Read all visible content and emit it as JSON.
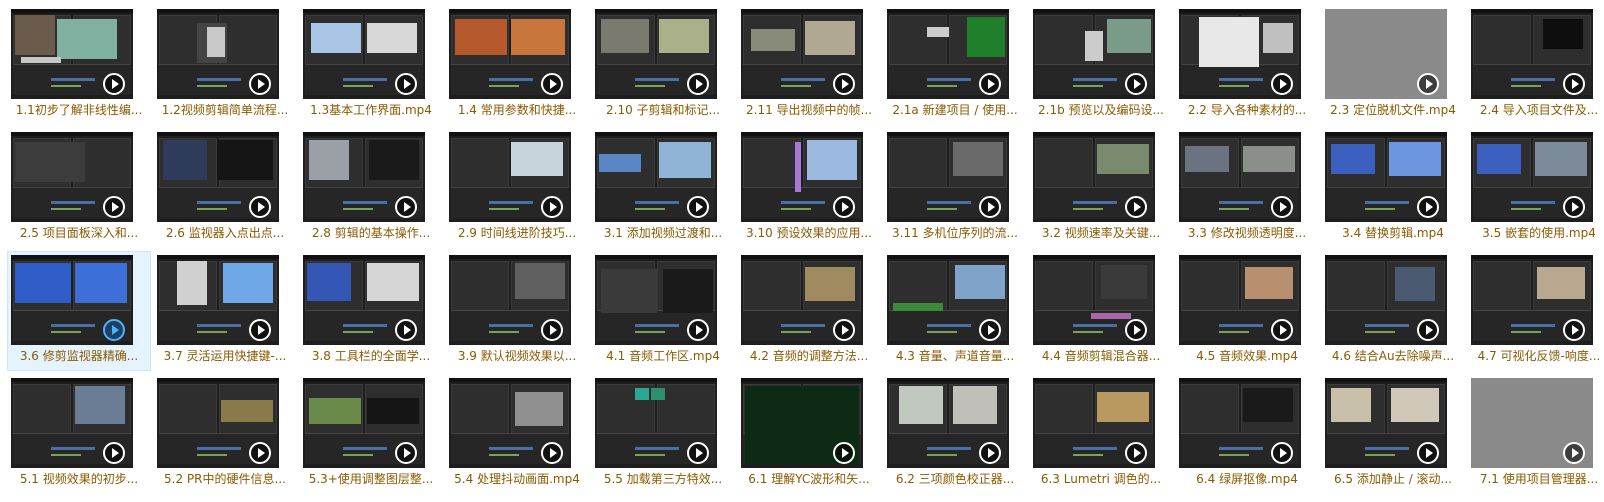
{
  "files": [
    {
      "name": "1.1初步了解非线性编...",
      "thumb": "photo-teal"
    },
    {
      "name": "1.2视频剪辑简单流程...",
      "thumb": "dialog"
    },
    {
      "name": "1.3基本工作界面.mp4",
      "thumb": "sky"
    },
    {
      "name": "1.4 常用参数和快捷...",
      "thumb": "desert"
    },
    {
      "name": "2.10 子剪辑和标记...",
      "thumb": "trees"
    },
    {
      "name": "2.11 导出视频中的帧...",
      "thumb": "landscape"
    },
    {
      "name": "2.1a 新建项目 / 使用...",
      "thumb": "green"
    },
    {
      "name": "2.1b 预览以及编码设...",
      "thumb": "mountain"
    },
    {
      "name": "2.2 导入各种素材的...",
      "thumb": "window"
    },
    {
      "name": "2.3 定位脱机文件.mp4",
      "thumb": "gray"
    },
    {
      "name": "2.4 导入项目文件及...",
      "thumb": "dark"
    },
    {
      "name": "2.5 项目面板深入和...",
      "thumb": "list"
    },
    {
      "name": "2.6 监视器入点出点...",
      "thumb": "blue-dark"
    },
    {
      "name": "2.8 剪辑的基本操作...",
      "thumb": "grid"
    },
    {
      "name": "2.9 时间线进阶技巧...",
      "thumb": "snow"
    },
    {
      "name": "3.1 添加视频过渡和...",
      "thumb": "sky2"
    },
    {
      "name": "3.10 预设效果的应用...",
      "thumb": "anime"
    },
    {
      "name": "3.11 多机位序列的流...",
      "thumb": "dark-person"
    },
    {
      "name": "3.2 视频速率及关键...",
      "thumb": "field"
    },
    {
      "name": "3.3 修改视频透明度...",
      "thumb": "mixed"
    },
    {
      "name": "3.4 替换剪辑.mp4",
      "thumb": "blue-sky"
    },
    {
      "name": "3.5 嵌套的使用.mp4",
      "thumb": "blue-sky2"
    },
    {
      "name": "3.6 修剪监视器精确...",
      "thumb": "blue"
    },
    {
      "name": "3.7 灵活运用快捷键-...",
      "thumb": "window-sky"
    },
    {
      "name": "3.8 工具栏的全面学...",
      "thumb": "blue-bw"
    },
    {
      "name": "3.9 默认视频效果以...",
      "thumb": "street"
    },
    {
      "name": "4.1 音频工作区.mp4",
      "thumb": "audio"
    },
    {
      "name": "4.2 音频的调整方法...",
      "thumb": "tan"
    },
    {
      "name": "4.3 音量、声道音量...",
      "thumb": "sky-wave"
    },
    {
      "name": "4.4 音频剪辑混合器...",
      "thumb": "trees2"
    },
    {
      "name": "4.5 音频效果.mp4",
      "thumb": "person"
    },
    {
      "name": "4.6 结合Au去除噪声...",
      "thumb": "person2"
    },
    {
      "name": "4.7 可视化反馈-响度...",
      "thumb": "person3"
    },
    {
      "name": "5.1 视频效果的初步...",
      "thumb": "person-blue"
    },
    {
      "name": "5.2 PR中的硬件信息...",
      "thumb": "field2"
    },
    {
      "name": "5.3+使用调整图层整...",
      "thumb": "green-field"
    },
    {
      "name": "5.4 处理抖动画面.mp4",
      "thumb": "walk"
    },
    {
      "name": "5.5 加载第三方特效...",
      "thumb": "teal-tiles"
    },
    {
      "name": "6.1 理解YC波形和矢...",
      "thumb": "waveform"
    },
    {
      "name": "6.2 三项颜色校正器...",
      "thumb": "color"
    },
    {
      "name": "6.3 Lumetri 调色的...",
      "thumb": "flowers"
    },
    {
      "name": "6.4 绿屏抠像.mp4",
      "thumb": "dark-green"
    },
    {
      "name": "6.5 添加静止 / 滚动...",
      "thumb": "dogs"
    },
    {
      "name": "7.1 使用项目管理器...",
      "thumb": "gray2"
    }
  ],
  "selected_index": 22,
  "colors": {
    "label": "#8a5a00",
    "selected_bg": "#e5f3ff",
    "play_active": "#4ab3ff"
  },
  "icons": {
    "play": "play-circle-icon"
  }
}
